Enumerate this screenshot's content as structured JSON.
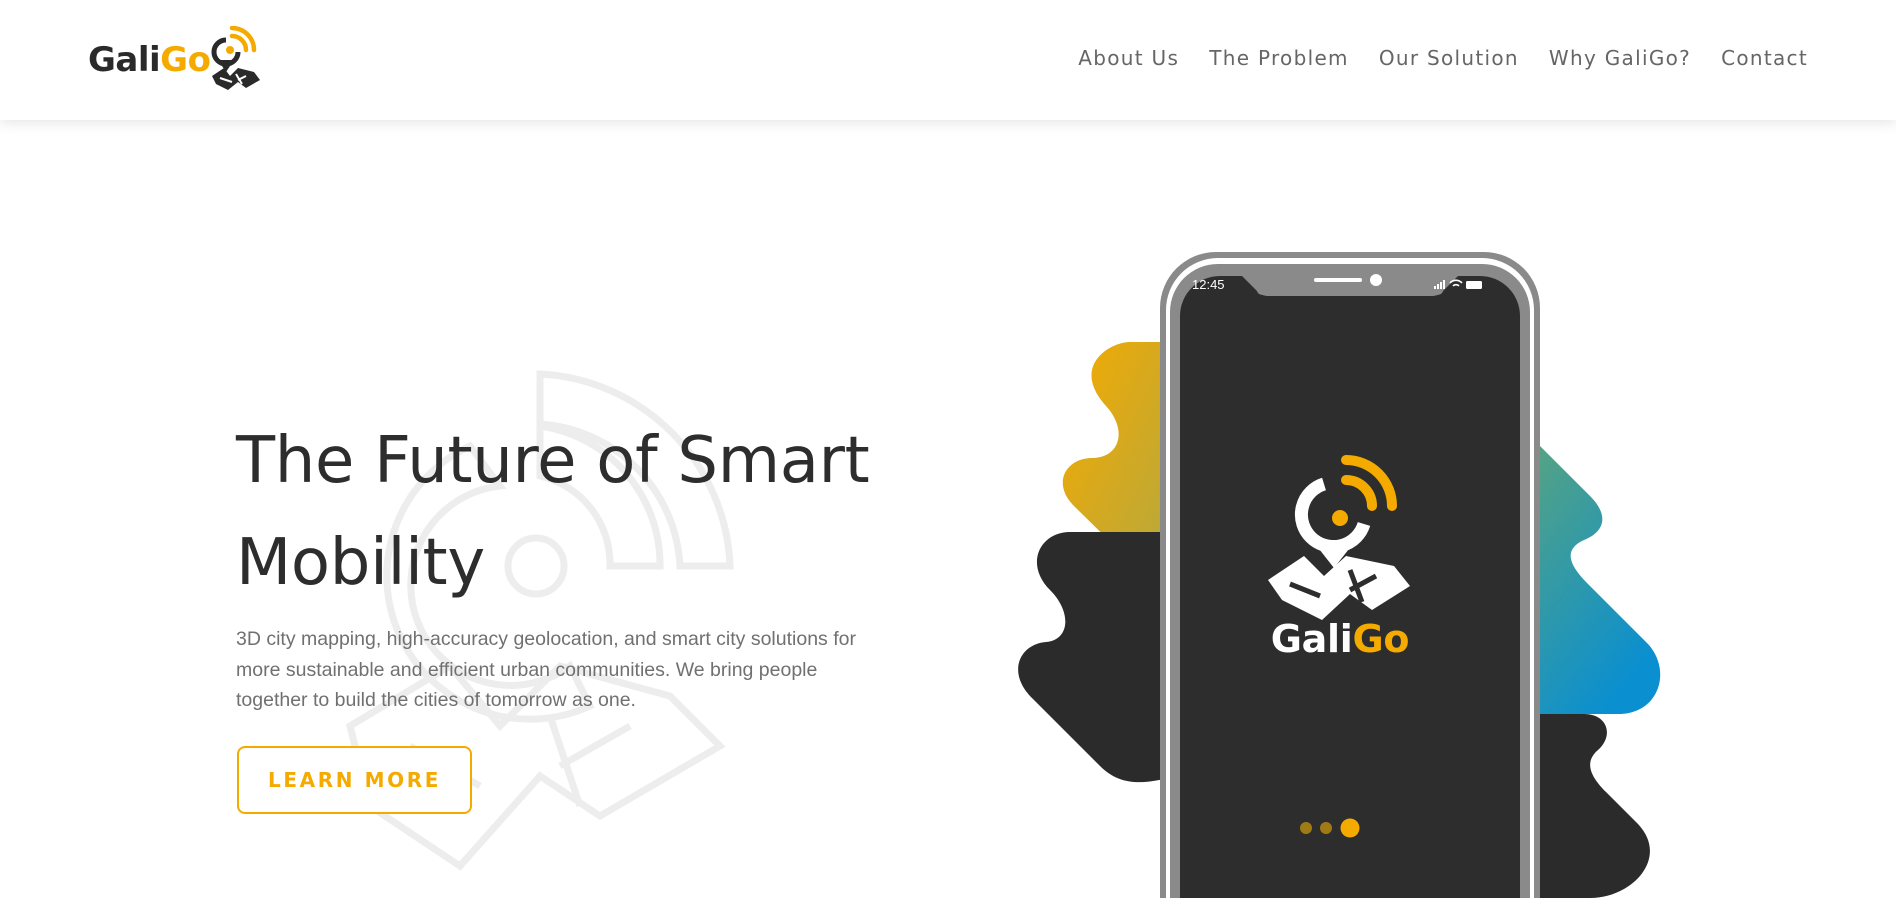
{
  "brand": {
    "logo_part1": "Gali",
    "logo_part2": "Go",
    "accent_color": "#f5aa00",
    "dark_color": "#2a2a2a"
  },
  "nav": {
    "items": [
      {
        "label": "About Us"
      },
      {
        "label": "The Problem"
      },
      {
        "label": "Our Solution"
      },
      {
        "label": "Why GaliGo?"
      },
      {
        "label": "Contact"
      }
    ]
  },
  "hero": {
    "title_line1": "The Future of Smart",
    "title_line2": "Mobility",
    "text_line1": "3D city mapping, high-accuracy geolocation, and smart city solutions for",
    "text_line2": "more sustainable and efficient urban communities. We bring people",
    "text_line3": "together to build the cities of tomorrow as one.",
    "button_label": "LEARN MORE"
  },
  "phone": {
    "status_time": "12:45",
    "app_name_part1": "Gali",
    "app_name_part2": "Go",
    "icons": [
      "signal-icon",
      "wifi-icon",
      "battery-icon"
    ],
    "pager_dots": 3,
    "pager_active_index": 2
  }
}
